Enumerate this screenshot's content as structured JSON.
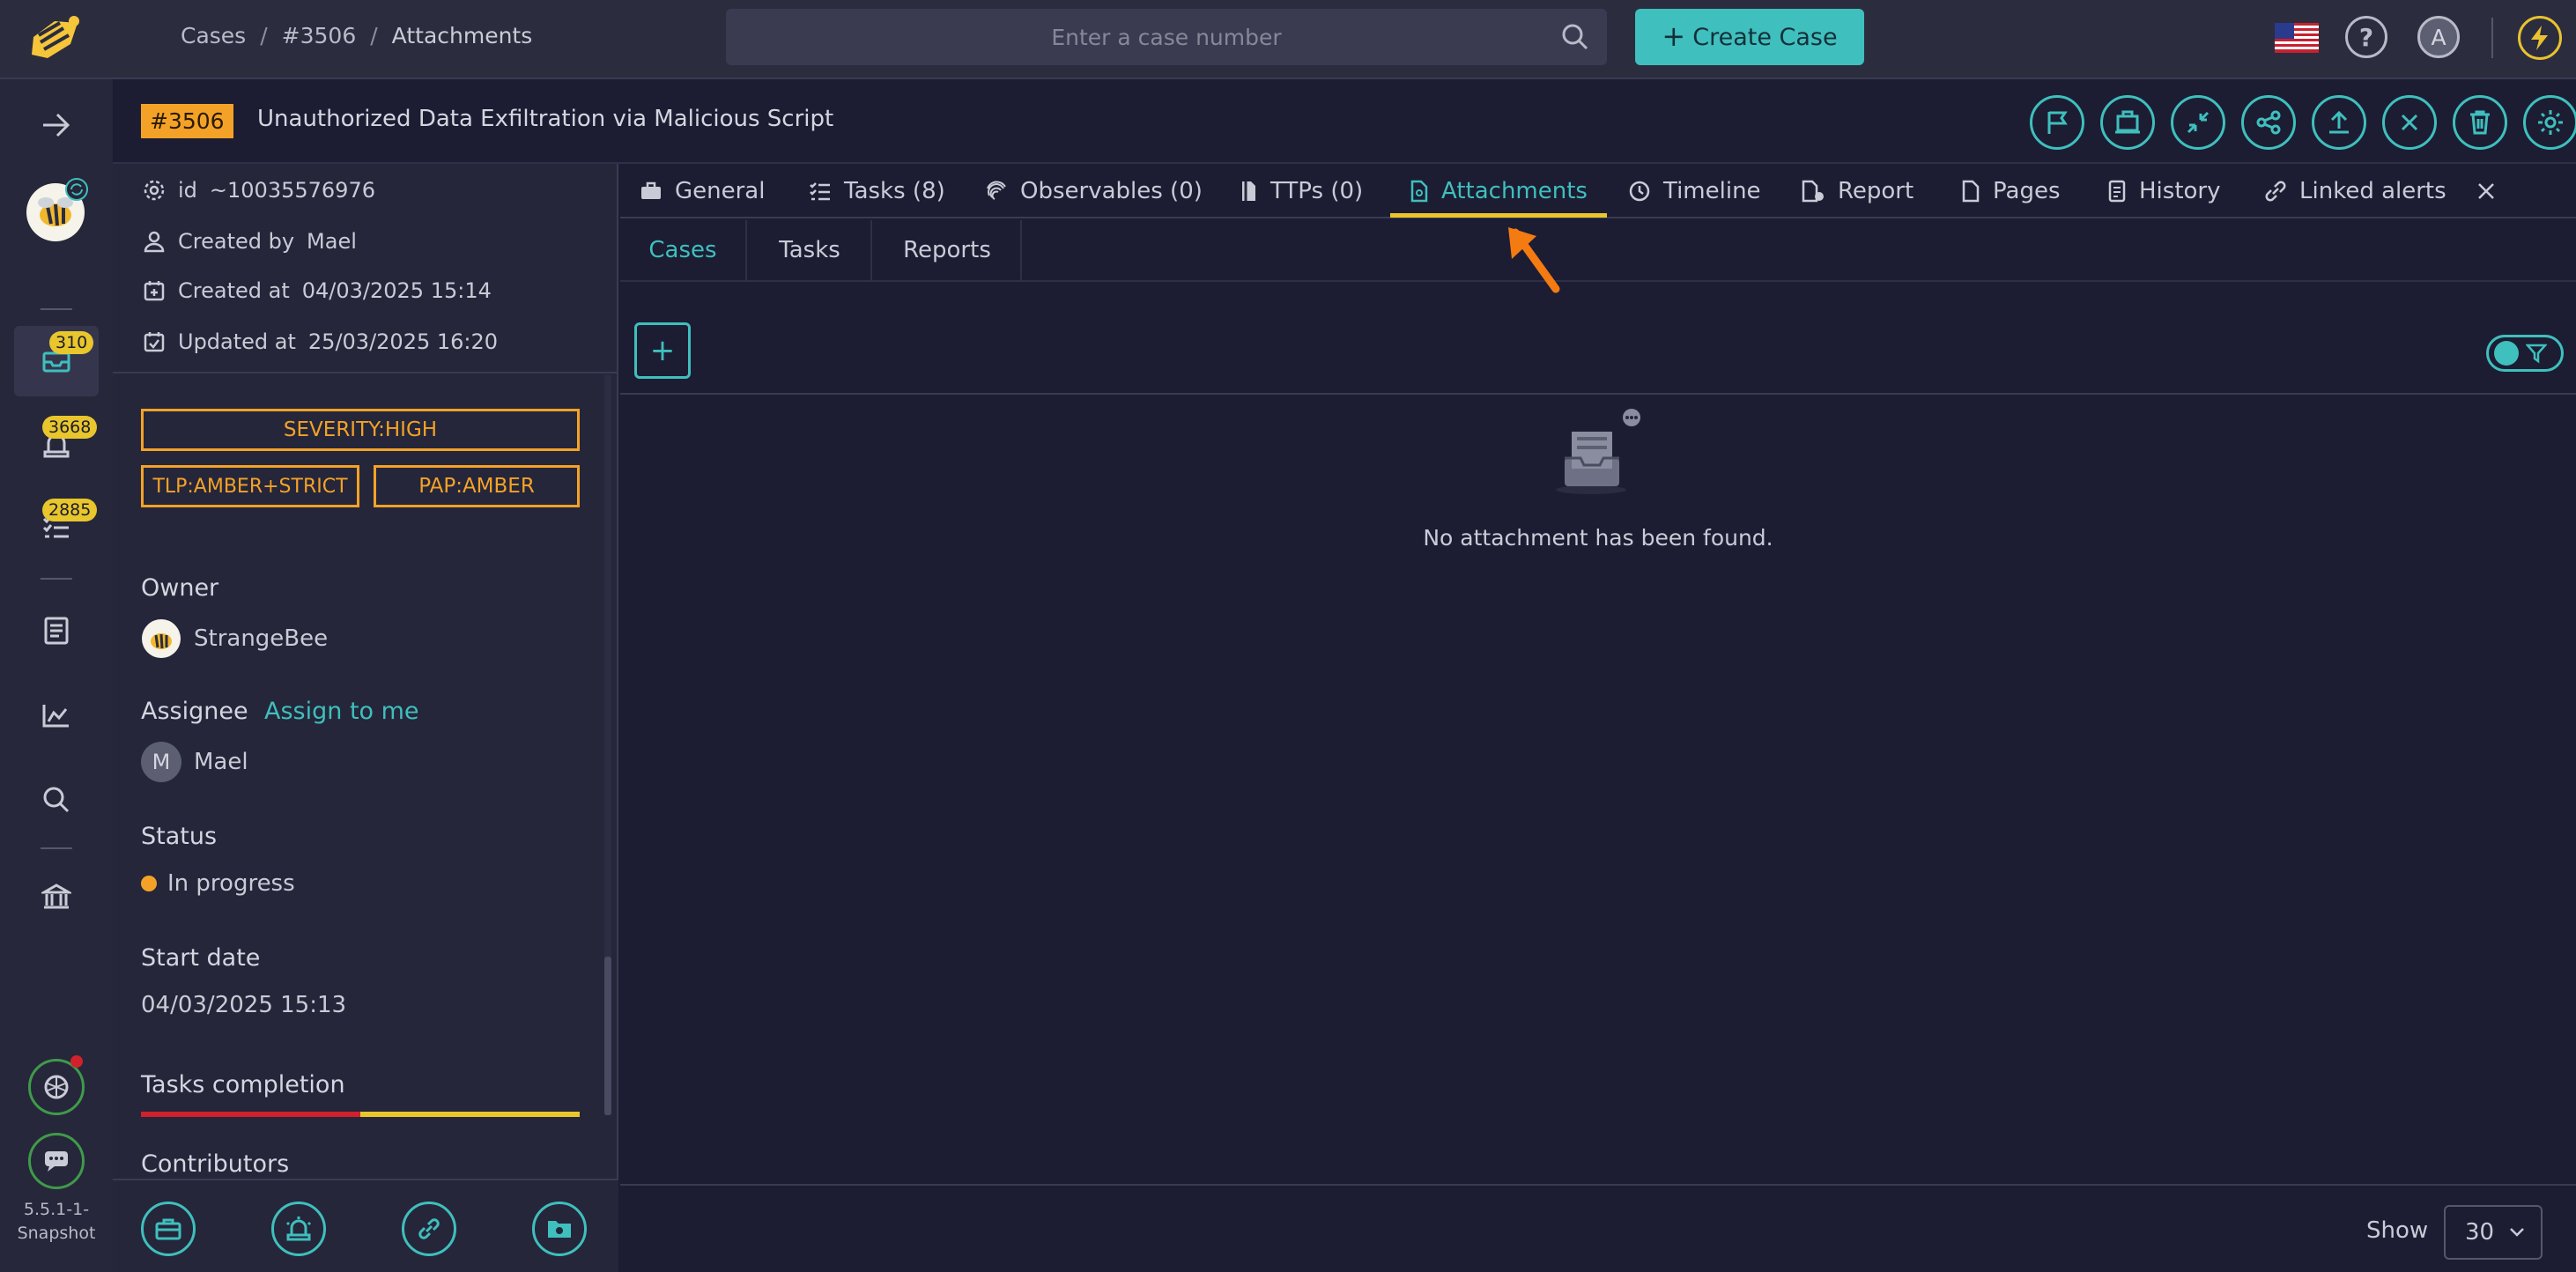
{
  "topbar": {
    "breadcrumb": [
      "Cases",
      "#3506",
      "Attachments"
    ],
    "breadcrumb_sep": "/",
    "search_placeholder": "Enter a case number",
    "create_label": "Create Case",
    "avatar_initial": "A"
  },
  "leftnav": {
    "badges": {
      "cases": "310",
      "alerts": "3668",
      "tasks": "2885"
    },
    "version": [
      "5.5.1-1-",
      "Snapshot"
    ]
  },
  "case": {
    "number": "#3506",
    "title": "Unauthorized Data Exfiltration via Malicious Script"
  },
  "details": {
    "id_label": "id",
    "id_value": "~10035576976",
    "created_by_label": "Created by",
    "created_by_value": "Mael",
    "created_at_label": "Created at",
    "created_at_value": "04/03/2025 15:14",
    "updated_at_label": "Updated at",
    "updated_at_value": "25/03/2025 16:20",
    "tags": [
      "SEVERITY:HIGH",
      "TLP:AMBER+STRICT",
      "PAP:AMBER"
    ],
    "owner_label": "Owner",
    "owner_value": "StrangeBee",
    "assignee_label": "Assignee",
    "assign_link": "Assign to me",
    "assignee_initial": "M",
    "assignee_value": "Mael",
    "status_label": "Status",
    "status_value": "In progress",
    "start_date_label": "Start date",
    "start_date_value": "04/03/2025 15:13",
    "tasks_completion_label": "Tasks completion",
    "tasks_completion_fraction": 0.5,
    "contributors_label": "Contributors"
  },
  "tabs": [
    {
      "label": "General",
      "icon": "briefcase-icon"
    },
    {
      "label": "Tasks (8)",
      "icon": "tasks-icon"
    },
    {
      "label": "Observables (0)",
      "icon": "fingerprint-icon"
    },
    {
      "label": "TTPs (0)",
      "icon": "ttp-icon"
    },
    {
      "label": "Attachments",
      "icon": "attachment-file-icon"
    },
    {
      "label": "Timeline",
      "icon": "clock-icon"
    },
    {
      "label": "Report",
      "icon": "report-icon"
    },
    {
      "label": "Pages",
      "icon": "page-icon"
    },
    {
      "label": "History",
      "icon": "history-icon"
    },
    {
      "label": "Linked alerts",
      "icon": "link-icon"
    }
  ],
  "subtabs": [
    "Cases",
    "Tasks",
    "Reports"
  ],
  "content": {
    "empty_message": "No attachment has been found."
  },
  "footer": {
    "show_label": "Show",
    "page_size": "30"
  },
  "colors": {
    "accent": "#3fbfbd",
    "case_badge": "#f4a227",
    "tab_underline": "#e8c62c",
    "progress_done": "#d0212c",
    "progress_rest": "#e8c62c"
  }
}
